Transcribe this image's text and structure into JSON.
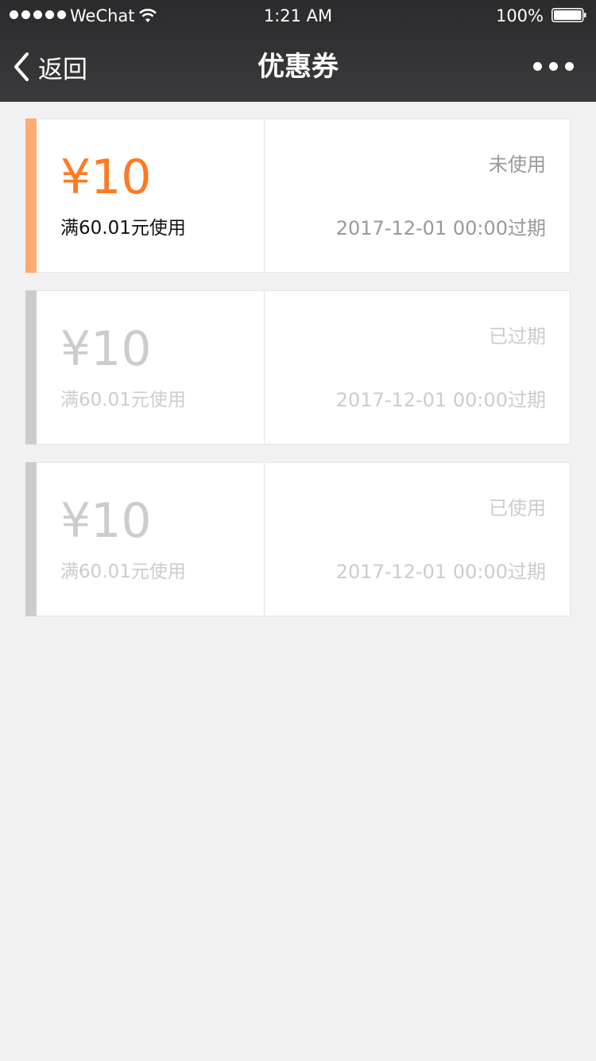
{
  "status_bar": {
    "carrier": "WeChat",
    "time": "1:21 AM",
    "battery": "100%"
  },
  "nav": {
    "back_label": "返回",
    "title": "优惠券"
  },
  "coupons": [
    {
      "amount": "¥10",
      "condition": "满60.01元使用",
      "state": "未使用",
      "expire": "2017-12-01 00:00过期",
      "stripe_color": "#ffab72",
      "amount_color": "#ff7a22"
    },
    {
      "amount": "¥10",
      "condition": "满60.01元使用",
      "state": "已过期",
      "expire": "2017-12-01 00:00过期",
      "stripe_color": "#cccccc"
    },
    {
      "amount": "¥10",
      "condition": "满60.01元使用",
      "state": "已使用",
      "expire": "2017-12-01 00:00过期",
      "stripe_color": "#cccccc"
    }
  ]
}
